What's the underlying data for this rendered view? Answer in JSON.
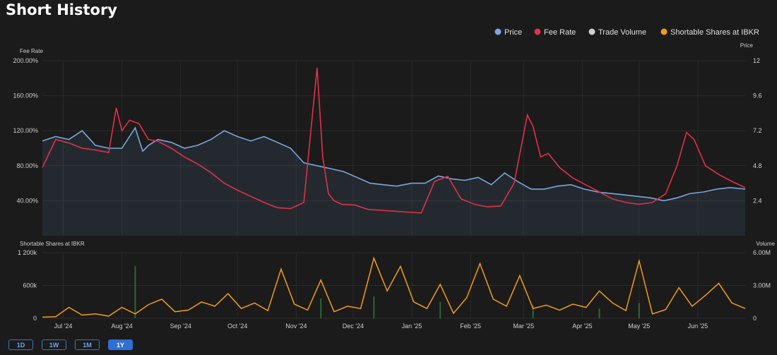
{
  "page": {
    "title": "Short History"
  },
  "colors": {
    "price": "#7aa7dd",
    "fee_rate": "#e23146",
    "trade_volume": "#cfcfcf",
    "shortable": "#f39c1a",
    "volume_bar": "#2e7d32"
  },
  "range_buttons": [
    {
      "label": "1D",
      "active": false
    },
    {
      "label": "1W",
      "active": false
    },
    {
      "label": "1M",
      "active": false
    },
    {
      "label": "1Y",
      "active": true
    }
  ],
  "chart_data": [
    {
      "type": "line",
      "legend": [
        "Price",
        "Fee Rate",
        "Trade Volume",
        "Shortable Shares at IBKR"
      ],
      "y_left_label": "Fee Rate",
      "y_right_label": "Price",
      "y_left_ticks": [
        "200.00%",
        "160.00%",
        "120.00%",
        "80.00%",
        "40.00%"
      ],
      "y_left_range": [
        0,
        200
      ],
      "y_right_ticks": [
        "12",
        "9.6",
        "7.2",
        "4.8",
        "2.4"
      ],
      "y_right_range": [
        0,
        12
      ],
      "x_ticks": [
        "Jul '24",
        "Aug '24",
        "Sep '24",
        "Oct '24",
        "Nov '24",
        "Dec '24",
        "Jan '25",
        "Feb '25",
        "Mar '25",
        "Apr '25",
        "May '25",
        "Jun '25"
      ],
      "x_range": [
        "2024-06-20",
        "2025-06-26"
      ],
      "series": [
        {
          "name": "Price",
          "axis": "right",
          "x": [
            "2024-06-20",
            "2024-06-27",
            "2024-07-04",
            "2024-07-11",
            "2024-07-18",
            "2024-07-25",
            "2024-08-01",
            "2024-08-08",
            "2024-08-12",
            "2024-08-15",
            "2024-08-20",
            "2024-08-27",
            "2024-09-03",
            "2024-09-10",
            "2024-09-17",
            "2024-09-24",
            "2024-10-01",
            "2024-10-08",
            "2024-10-15",
            "2024-10-22",
            "2024-10-29",
            "2024-11-05",
            "2024-11-12",
            "2024-11-19",
            "2024-11-26",
            "2024-12-03",
            "2024-12-10",
            "2024-12-17",
            "2024-12-24",
            "2025-01-01",
            "2025-01-08",
            "2025-01-15",
            "2025-01-22",
            "2025-01-29",
            "2025-02-05",
            "2025-02-12",
            "2025-02-19",
            "2025-02-26",
            "2025-03-05",
            "2025-03-12",
            "2025-03-19",
            "2025-03-26",
            "2025-04-02",
            "2025-04-09",
            "2025-04-16",
            "2025-04-23",
            "2025-04-30",
            "2025-05-07",
            "2025-05-14",
            "2025-05-21",
            "2025-05-28",
            "2025-06-04",
            "2025-06-11",
            "2025-06-18",
            "2025-06-26"
          ],
          "values": [
            6.5,
            6.8,
            6.6,
            7.2,
            6.2,
            6.0,
            6.0,
            7.4,
            5.8,
            6.2,
            6.6,
            6.4,
            6.0,
            6.2,
            6.6,
            7.2,
            6.8,
            6.5,
            6.8,
            6.4,
            6.0,
            5.0,
            4.8,
            4.6,
            4.4,
            4.0,
            3.6,
            3.5,
            3.4,
            3.6,
            3.6,
            4.1,
            3.9,
            3.8,
            4.0,
            3.5,
            4.3,
            3.7,
            3.2,
            3.2,
            3.4,
            3.5,
            3.2,
            3.0,
            2.9,
            2.8,
            2.7,
            2.6,
            2.4,
            2.6,
            2.9,
            3.0,
            3.2,
            3.3,
            3.2
          ]
        },
        {
          "name": "Fee Rate",
          "axis": "left",
          "x": [
            "2024-06-20",
            "2024-06-27",
            "2024-07-04",
            "2024-07-11",
            "2024-07-18",
            "2024-07-25",
            "2024-07-29",
            "2024-08-01",
            "2024-08-05",
            "2024-08-10",
            "2024-08-15",
            "2024-08-20",
            "2024-08-27",
            "2024-09-03",
            "2024-09-10",
            "2024-09-17",
            "2024-09-24",
            "2024-10-01",
            "2024-10-08",
            "2024-10-15",
            "2024-10-22",
            "2024-10-29",
            "2024-11-05",
            "2024-11-12",
            "2024-11-15",
            "2024-11-18",
            "2024-11-21",
            "2024-11-25",
            "2024-12-02",
            "2024-12-09",
            "2024-12-16",
            "2024-12-23",
            "2024-12-30",
            "2025-01-06",
            "2025-01-13",
            "2025-01-20",
            "2025-01-27",
            "2025-02-03",
            "2025-02-10",
            "2025-02-17",
            "2025-02-24",
            "2025-03-03",
            "2025-03-06",
            "2025-03-10",
            "2025-03-14",
            "2025-03-20",
            "2025-03-27",
            "2025-04-03",
            "2025-04-10",
            "2025-04-17",
            "2025-04-24",
            "2025-05-01",
            "2025-05-08",
            "2025-05-15",
            "2025-05-21",
            "2025-05-26",
            "2025-05-30",
            "2025-06-05",
            "2025-06-12",
            "2025-06-19",
            "2025-06-26"
          ],
          "values": [
            78,
            110,
            106,
            100,
            98,
            95,
            146,
            120,
            132,
            128,
            110,
            108,
            100,
            90,
            82,
            72,
            60,
            52,
            45,
            38,
            32,
            31,
            38,
            192,
            90,
            48,
            40,
            36,
            35,
            30,
            29,
            28,
            27,
            26,
            62,
            68,
            42,
            36,
            33,
            34,
            60,
            138,
            125,
            90,
            94,
            78,
            66,
            58,
            50,
            42,
            38,
            36,
            38,
            48,
            80,
            118,
            110,
            80,
            70,
            62,
            55
          ]
        }
      ]
    },
    {
      "type": "line",
      "y_left_label": "Shortable Shares at IBKR",
      "y_right_label": "Volume",
      "y_left_ticks": [
        "1 200k",
        "600k",
        "0"
      ],
      "y_left_range": [
        0,
        1200000
      ],
      "y_right_ticks": [
        "6.00M",
        "3.00M",
        "0"
      ],
      "y_right_range": [
        0,
        6000000
      ],
      "series": [
        {
          "name": "Shortable Shares at IBKR",
          "axis": "left",
          "x": [
            "2024-06-20",
            "2024-06-27",
            "2024-07-04",
            "2024-07-11",
            "2024-07-18",
            "2024-07-25",
            "2024-08-01",
            "2024-08-08",
            "2024-08-15",
            "2024-08-22",
            "2024-08-29",
            "2024-09-05",
            "2024-09-12",
            "2024-09-19",
            "2024-09-26",
            "2024-10-03",
            "2024-10-10",
            "2024-10-17",
            "2024-10-24",
            "2024-10-31",
            "2024-11-07",
            "2024-11-14",
            "2024-11-21",
            "2024-11-28",
            "2024-12-05",
            "2024-12-12",
            "2024-12-19",
            "2024-12-26",
            "2025-01-02",
            "2025-01-09",
            "2025-01-16",
            "2025-01-23",
            "2025-01-30",
            "2025-02-06",
            "2025-02-13",
            "2025-02-20",
            "2025-02-27",
            "2025-03-06",
            "2025-03-13",
            "2025-03-20",
            "2025-03-27",
            "2025-04-03",
            "2025-04-10",
            "2025-04-17",
            "2025-04-24",
            "2025-05-01",
            "2025-05-08",
            "2025-05-15",
            "2025-05-22",
            "2025-05-29",
            "2025-06-05",
            "2025-06-12",
            "2025-06-19",
            "2025-06-26"
          ],
          "values": [
            20000,
            30000,
            200000,
            60000,
            80000,
            40000,
            200000,
            80000,
            250000,
            350000,
            120000,
            150000,
            300000,
            220000,
            450000,
            180000,
            280000,
            140000,
            900000,
            260000,
            150000,
            700000,
            120000,
            220000,
            180000,
            1100000,
            500000,
            950000,
            300000,
            180000,
            620000,
            90000,
            380000,
            1000000,
            350000,
            220000,
            780000,
            180000,
            240000,
            150000,
            260000,
            200000,
            500000,
            280000,
            140000,
            1050000,
            80000,
            160000,
            560000,
            220000,
            420000,
            640000,
            280000,
            180000
          ]
        },
        {
          "name": "Trade Volume",
          "axis": "right",
          "x": [
            "2024-08-08",
            "2024-11-14",
            "2024-12-12",
            "2025-01-16",
            "2025-03-06",
            "2025-04-10",
            "2025-05-01"
          ],
          "values": [
            4800000,
            1800000,
            2000000,
            1500000,
            1200000,
            900000,
            1400000
          ]
        }
      ]
    }
  ]
}
